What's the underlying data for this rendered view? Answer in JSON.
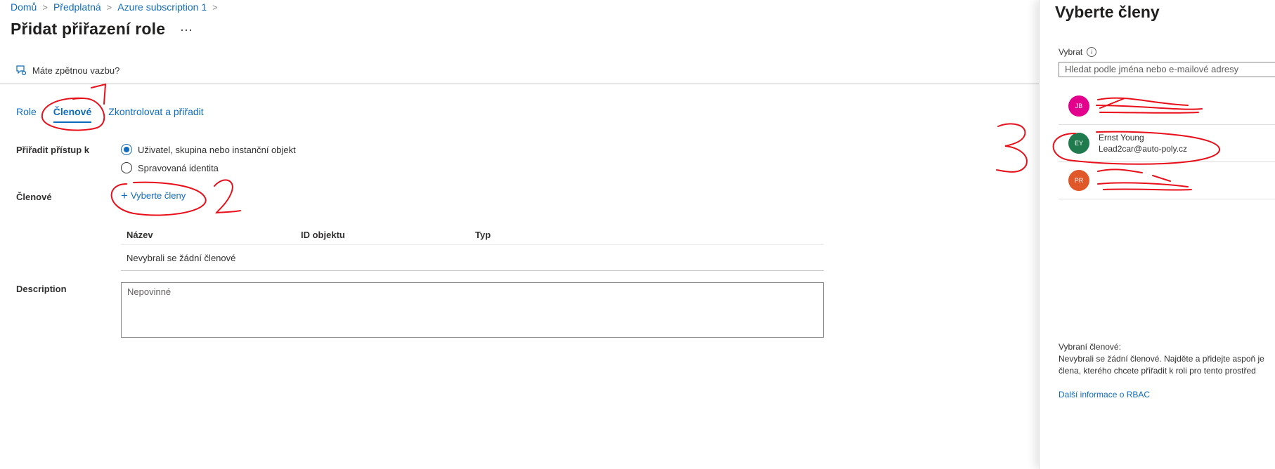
{
  "breadcrumb": {
    "items": [
      "Domů",
      "Předplatná",
      "Azure subscription 1"
    ],
    "separator": ">"
  },
  "page": {
    "title": "Přidat přiřazení role",
    "more": "···"
  },
  "feedback": {
    "label": "Máte zpětnou vazbu?"
  },
  "tabs": [
    {
      "label": "Role",
      "active": false
    },
    {
      "label": "Členové",
      "active": true
    },
    {
      "label": "Zkontrolovat a přiřadit",
      "active": false
    }
  ],
  "form": {
    "assign_access_label": "Přiřadit přístup k",
    "options": [
      {
        "label": "Uživatel, skupina nebo instanční objekt",
        "checked": true
      },
      {
        "label": "Spravovaná identita",
        "checked": false
      }
    ],
    "members_label": "Členové",
    "select_members_link": "Vyberte členy",
    "table": {
      "columns": [
        "Název",
        "ID objektu",
        "Typ"
      ],
      "empty_text": "Nevybrali se žádní členové"
    },
    "description_label": "Description",
    "description_placeholder": "Nepovinné"
  },
  "panel": {
    "title": "Vyberte členy",
    "select_label": "Vybrat",
    "search_placeholder": "Hledat podle jména nebo e-mailové adresy",
    "members": [
      {
        "initials": "JB",
        "color": "#e3008c",
        "name": "",
        "email": ""
      },
      {
        "initials": "EY",
        "color": "#1f7a4d",
        "name": "Ernst Young",
        "email": "Lead2car@auto-poly.cz"
      },
      {
        "initials": "PR",
        "color": "#e0572a",
        "name": "",
        "email": ""
      }
    ],
    "selected_label": "Vybraní členové:",
    "selected_text_line1": "Nevybrali se žádní členové. Najděte a přidejte aspoň je",
    "selected_text_line2": "člena, kterého chcete přiřadit k roli pro tento prostřed",
    "rbac_link": "Další informace o RBAC"
  },
  "annotations": [
    "1",
    "2",
    "3"
  ],
  "colors": {
    "accent": "#0f6cbd",
    "annotation": "#e8101a"
  }
}
